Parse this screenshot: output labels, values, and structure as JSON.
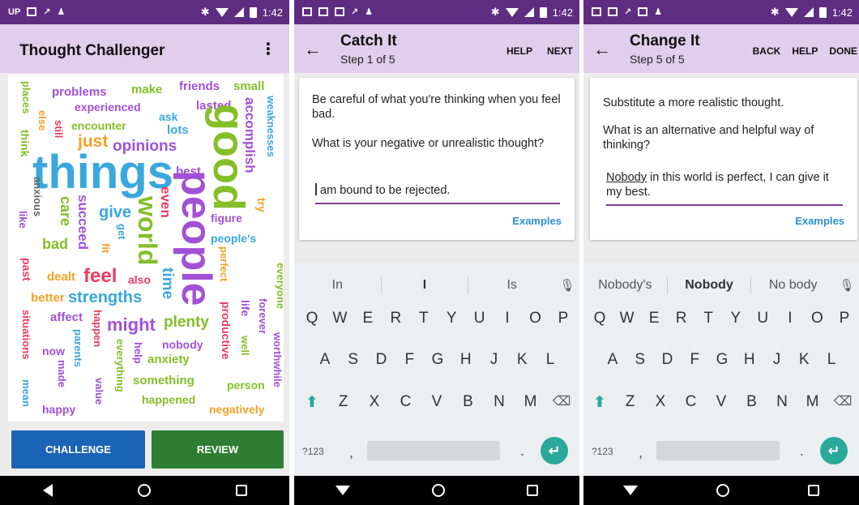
{
  "status": {
    "left_badge": "UP",
    "time": "1:42",
    "bluetooth": "✱"
  },
  "screen1": {
    "title": "Thought Challenger",
    "menu_icon": "⋮",
    "words": {
      "things": "things",
      "people": "people",
      "good": "good",
      "world": "world",
      "feel": "feel",
      "strengths": "strengths",
      "might": "might",
      "plenty": "plenty",
      "opinions": "opinions",
      "just": "just",
      "problems": "problems",
      "make": "make",
      "friends": "friends",
      "small": "small",
      "experienced": "experienced",
      "ask": "ask",
      "lasted": "lasted",
      "lots": "lots",
      "encounter": "encounter",
      "accomplish": "accomplish",
      "weaknesses": "weaknesses",
      "places": "places",
      "else": "else",
      "think": "think",
      "still": "still",
      "best": "best",
      "anxious": "anxious",
      "care": "care",
      "succeed": "succeed",
      "give": "give",
      "even": "even",
      "try": "try",
      "figure": "figure",
      "like": "like",
      "bad": "bad",
      "get": "get",
      "fit": "fit",
      "people_s": "people's",
      "past": "past",
      "dealt": "dealt",
      "also": "also",
      "time": "time",
      "perfect": "perfect",
      "everyone": "everyone",
      "better": "better",
      "affect": "affect",
      "happen": "happen",
      "productive": "productive",
      "life": "life",
      "forever": "forever",
      "worthwhile": "worthwhile",
      "situations": "situations",
      "now": "now",
      "parents": "parents",
      "everything": "everything",
      "help": "help",
      "nobody": "nobody",
      "well": "well",
      "anxiety": "anxiety",
      "made": "made",
      "value": "value",
      "something": "something",
      "person": "person",
      "mean": "mean",
      "happy": "happy",
      "happened": "happened",
      "negatively": "negatively"
    },
    "buttons": {
      "challenge": "CHALLENGE",
      "review": "REVIEW"
    }
  },
  "screen2": {
    "title": "Catch It",
    "step": "Step 1 of 5",
    "actions": [
      "HELP",
      "NEXT"
    ],
    "prompt": "Be careful of what you're thinking when you feel bad.",
    "question": "What is your negative or unrealistic thought?",
    "answer": "am bound to be rejected.",
    "examples": "Examples",
    "suggestions": [
      "In",
      "I",
      "Is"
    ]
  },
  "screen3": {
    "title": "Change It",
    "step": "Step 5 of 5",
    "actions": [
      "BACK",
      "HELP",
      "DONE"
    ],
    "prompt": "Substitute a more realistic thought.",
    "question": "What is an alternative and helpful way of thinking?",
    "answer_first": "Nobody",
    "answer_rest": " in this world is perfect, I can give it my best.",
    "examples": "Examples",
    "suggestions": [
      "Nobody's",
      "Nobody",
      "No body"
    ]
  },
  "keyboard": {
    "row1": [
      "Q",
      "W",
      "E",
      "R",
      "T",
      "Y",
      "U",
      "I",
      "O",
      "P"
    ],
    "row2": [
      "A",
      "S",
      "D",
      "F",
      "G",
      "H",
      "J",
      "K",
      "L"
    ],
    "row3": [
      "Z",
      "X",
      "C",
      "V",
      "B",
      "N",
      "M"
    ],
    "symbols": "?123",
    "comma": ",",
    "period": "."
  },
  "colors": {
    "status_bar": "#5e2d82",
    "app_bar": "#e1cdec",
    "challenge": "#1b63b5",
    "review": "#2e7d32",
    "accent": "#2a90d0"
  }
}
